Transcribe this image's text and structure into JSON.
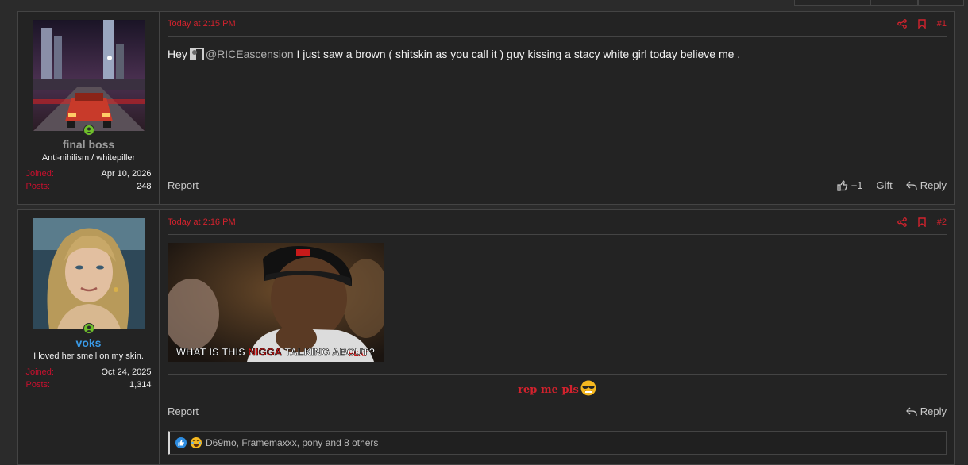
{
  "posts": [
    {
      "user": {
        "name": "final boss",
        "title": "Anti-nihilism / whitepiller",
        "joined_label": "Joined:",
        "joined_value": "Apr 10, 2026",
        "posts_label": "Posts:",
        "posts_value": "248"
      },
      "time": "Today at 2:15 PM",
      "number": "#1",
      "body": {
        "greeting": "Hey",
        "mention": "@RICEascension",
        "text": " I just saw a brown ( shitskin as you call it ) guy kissing a stacy white girl today believe me ."
      },
      "footer": {
        "report": "Report",
        "like": "+1",
        "gift": "Gift",
        "reply": "Reply"
      }
    },
    {
      "user": {
        "name": "voks",
        "title": "I loved her smell on my skin.",
        "joined_label": "Joined:",
        "joined_value": "Oct 24, 2025",
        "posts_label": "Posts:",
        "posts_value": "1,314"
      },
      "time": "Today at 2:16 PM",
      "number": "#2",
      "meme": {
        "caption_before": "WHAT IS THIS ",
        "caption_highlight": "NIGGA",
        "caption_after": " TALKING ABOUT?",
        "jersey": "HEAT"
      },
      "signature": "rep me pls",
      "footer": {
        "report": "Report",
        "reply": "Reply"
      },
      "reactions": "D69mo, Framemaxxx, pony and 8 others"
    }
  ],
  "colors": {
    "accent": "#d2222d",
    "username_default": "#9a9a9a",
    "username_blue": "#3a9ae6",
    "online": "#6fbf2a"
  },
  "icons": [
    "online-icon",
    "share-icon",
    "bookmark-icon",
    "thumbs-up-icon",
    "reply-icon",
    "like-reaction-icon",
    "laugh-reaction-icon",
    "sunglasses-emoji-icon"
  ]
}
